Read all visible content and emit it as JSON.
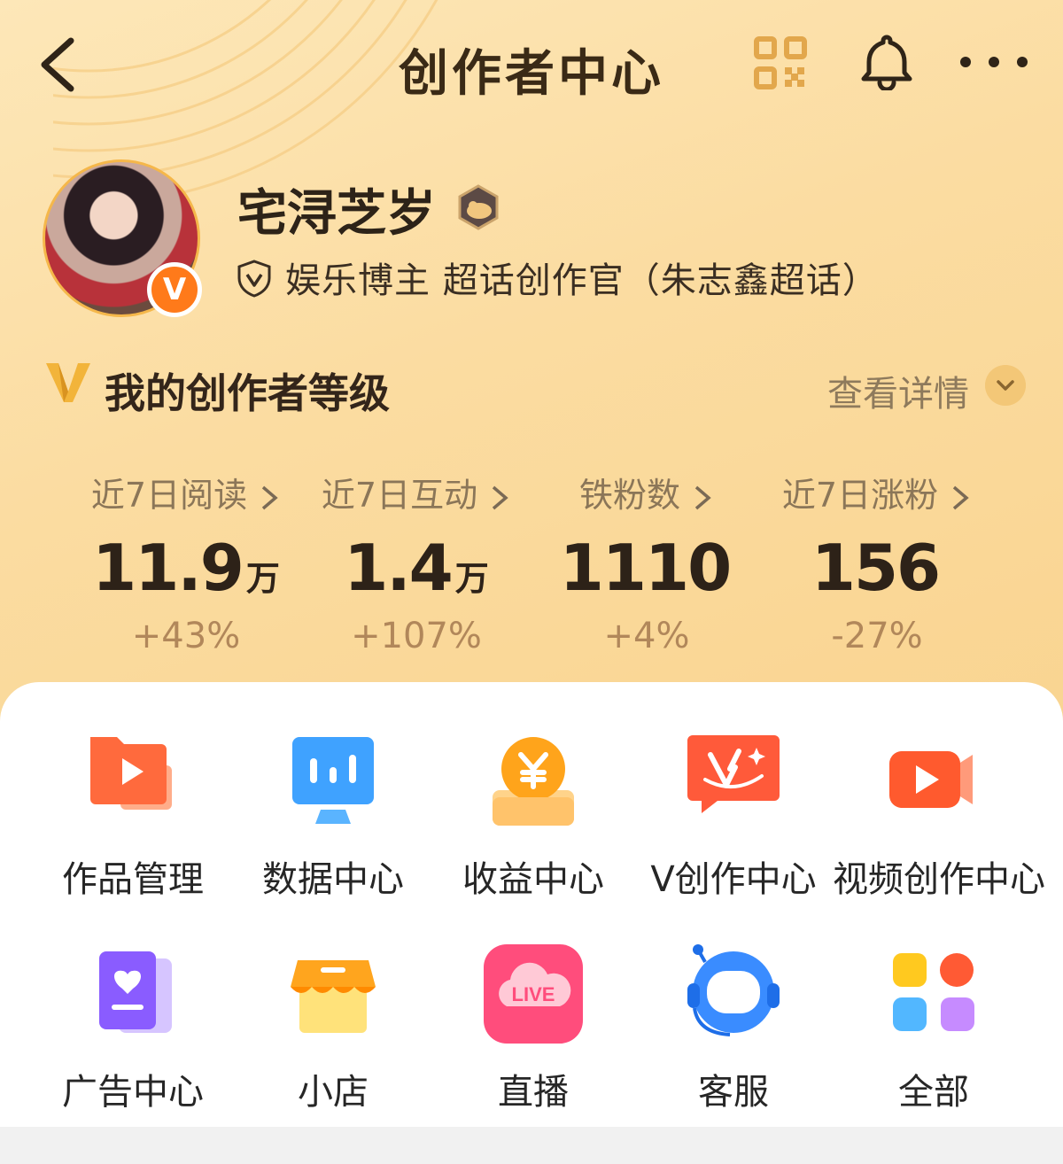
{
  "header": {
    "title": "创作者中心"
  },
  "profile": {
    "name": "宅浔芝岁",
    "badge_letter": "V",
    "verification": "娱乐博主 超话创作官（朱志鑫超话）"
  },
  "level": {
    "title": "我的创作者等级",
    "detail_label": "查看详情"
  },
  "stats": [
    {
      "label": "近7日阅读",
      "value": "11.9",
      "unit": "万",
      "change": "+43%"
    },
    {
      "label": "近7日互动",
      "value": "1.4",
      "unit": "万",
      "change": "+107%"
    },
    {
      "label": "铁粉数",
      "value": "1110",
      "unit": "",
      "change": "+4%"
    },
    {
      "label": "近7日涨粉",
      "value": "156",
      "unit": "",
      "change": "-27%"
    }
  ],
  "tools_row1": [
    {
      "label": "作品管理",
      "icon": "works-folder-icon"
    },
    {
      "label": "数据中心",
      "icon": "data-chart-icon"
    },
    {
      "label": "收益中心",
      "icon": "yuan-coin-icon"
    },
    {
      "label": "V创作中心",
      "icon": "v-create-icon"
    },
    {
      "label": "视频创作中心",
      "icon": "video-camera-icon"
    }
  ],
  "tools_row2": [
    {
      "label": "广告中心",
      "icon": "ad-heart-icon"
    },
    {
      "label": "小店",
      "icon": "shop-icon"
    },
    {
      "label": "直播",
      "icon": "live-icon",
      "icon_text": "LIVE"
    },
    {
      "label": "客服",
      "icon": "support-headset-icon"
    },
    {
      "label": "全部",
      "icon": "all-grid-icon"
    }
  ],
  "colors": {
    "hero_start": "#fde7b8",
    "hero_end": "#f9d490",
    "title_text": "#3a2a16",
    "stat_label": "#8b7658",
    "stat_change": "#b1875a",
    "accent_orange": "#ff7a1a"
  }
}
